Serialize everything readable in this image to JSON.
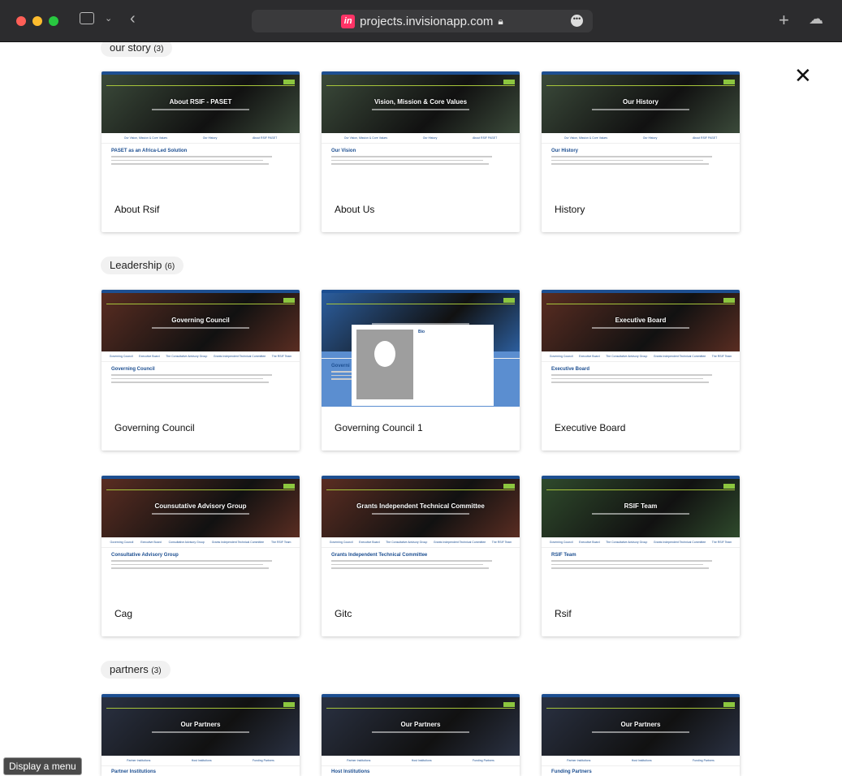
{
  "browser": {
    "url": "projects.invisionapp.com",
    "invision_badge": "in",
    "more_label": "•••",
    "colors": {
      "close": "#ff5f57",
      "min": "#febc2e",
      "max": "#28c840"
    }
  },
  "tooltip": "Display a menu",
  "sections": [
    {
      "title": "our story",
      "count": "(3)",
      "cards": [
        {
          "name": "About Rsif",
          "hero": "About RSIF - PASET",
          "photo": "#3b4a3a",
          "tabs": [
            "Our Vision, Mission & Core Values",
            "Our History",
            "About RSIF PASET"
          ],
          "heading": "PASET as an Africa-Led Solution"
        },
        {
          "name": "About Us",
          "hero": "Vision, Mission & Core Values",
          "photo": "#3b4a3a",
          "tabs": [
            "Our Vision, Mission & Core Values",
            "Our History",
            "About RSIF PASET"
          ],
          "heading": "Our Vision"
        },
        {
          "name": "History",
          "hero": "Our History",
          "photo": "#3b4a3a",
          "tabs": [
            "Our Vision, Mission & Core Values",
            "Our History",
            "About RSIF PASET"
          ],
          "heading": "Our History"
        }
      ]
    },
    {
      "title": "Leadership",
      "count": "(6)",
      "cards": [
        {
          "name": "Governing Council",
          "hero": "Governing Council",
          "photo": "#5a2d22",
          "tabs": [
            "Governing Council",
            "Executive Board",
            "The Consultative Advisory Group",
            "Grants Independent Technical Committee",
            "The RSIF Team"
          ],
          "heading": "Governing Council"
        },
        {
          "name": "Governing Council 1",
          "hero": "",
          "photo": "#2c5e9e",
          "tabs": [],
          "heading": "Governi",
          "modal_title": "Bio"
        },
        {
          "name": "Executive Board",
          "hero": "Executive Board",
          "photo": "#5a2d22",
          "tabs": [
            "Governing Council",
            "Executive Board",
            "The Consultative Advisory Group",
            "Grants Independent Technical Committee",
            "The RSIF Team"
          ],
          "heading": "Executive Board"
        },
        {
          "name": "Cag",
          "hero": "Counsutative Advisory Group",
          "photo": "#5a2d22",
          "tabs": [
            "Governing Council",
            "Executive Board",
            "Consultative Advisory Group",
            "Grants Independent Technical Committee",
            "The RSIF Team"
          ],
          "heading": "Consultative Advisory Group"
        },
        {
          "name": "Gitc",
          "hero": "Grants Independent Technical Committee",
          "photo": "#5a2d22",
          "tabs": [
            "Governing Council",
            "Executive Board",
            "The Consultative Advisory Group",
            "Grants Independent Technical Committee",
            "The RSIF Team"
          ],
          "heading": "Grants Independent Technical Committee"
        },
        {
          "name": "Rsif",
          "hero": "RSIF Team",
          "photo": "#2f4a2c",
          "tabs": [
            "Governing Council",
            "Executive Board",
            "The Consultative Advisory Group",
            "Grants Independent Technical Committee",
            "The RSIF Team"
          ],
          "heading": "RSIF Team"
        }
      ]
    },
    {
      "title": "partners",
      "count": "(3)",
      "cards": [
        {
          "name": "",
          "hero": "Our Partners",
          "photo": "#2a3142",
          "tabs": [
            "Partner Institutions",
            "Host Institutions",
            "Funding Partners"
          ],
          "heading": "Partner Institutions"
        },
        {
          "name": "",
          "hero": "Our Partners",
          "photo": "#2a3142",
          "tabs": [
            "Partner Institutions",
            "Host Institutions",
            "Funding Partners"
          ],
          "heading": "Host Institutions"
        },
        {
          "name": "",
          "hero": "Our Partners",
          "photo": "#2a3142",
          "tabs": [
            "Partner Institutions",
            "Host Institutions",
            "Funding Partners"
          ],
          "heading": "Funding Partners"
        }
      ]
    }
  ]
}
